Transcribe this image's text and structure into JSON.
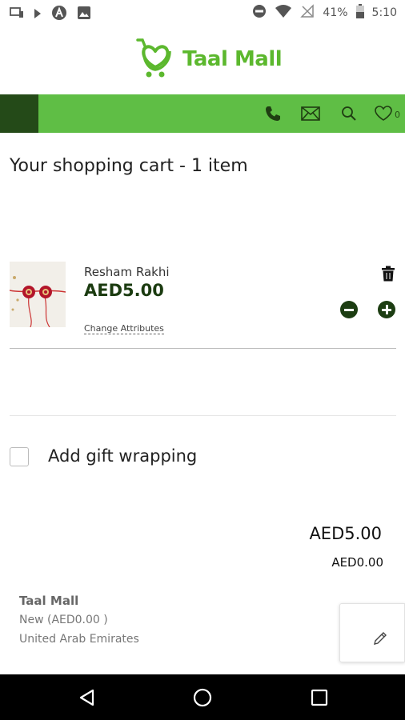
{
  "status_bar": {
    "battery": "41%",
    "time": "5:10",
    "icons": [
      "cast-icon",
      "play-icon",
      "a-icon",
      "image-icon",
      "do-not-disturb-icon",
      "wifi-icon",
      "no-signal-icon",
      "battery-icon"
    ]
  },
  "header": {
    "logo_text": "Taal Mall",
    "brand_color": "#5cb82e"
  },
  "nav": {
    "bar_color": "#5fbe45",
    "menu_block_color": "#244a18",
    "icons": [
      "phone-icon",
      "mail-icon",
      "search-icon",
      "heart-icon"
    ],
    "wishlist_count": "0"
  },
  "cart": {
    "title": "Your shopping cart - 1 item",
    "items": [
      {
        "name": "Resham Rakhi",
        "price": "AED5.00",
        "change_attributes_label": "Change Attributes"
      }
    ]
  },
  "gift_wrap": {
    "label": "Add gift wrapping",
    "checked": false
  },
  "totals": {
    "total": "AED5.00",
    "sub_total": "AED0.00"
  },
  "address": {
    "name": "Taal Mall",
    "line1": "New (AED0.00 )",
    "line2": "United Arab Emirates"
  },
  "bottom_nav": {
    "buttons": [
      "back-icon",
      "home-icon",
      "recents-icon"
    ]
  }
}
